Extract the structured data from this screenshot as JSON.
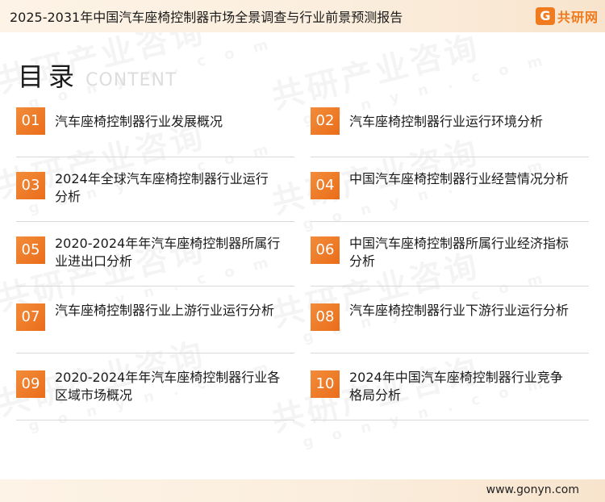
{
  "header": {
    "title": "2025-2031年中国汽车座椅控制器市场全景调查与行业前景预测报告"
  },
  "logo": {
    "badge": "G",
    "text": "共研网"
  },
  "watermark": {
    "text": "共研产业咨询",
    "url": "g o n y n . c o m"
  },
  "toc": {
    "title": "目录",
    "subtitle": "CONTENT",
    "items": [
      {
        "num": "01",
        "label": "汽车座椅控制器行业发展概况"
      },
      {
        "num": "02",
        "label": "汽车座椅控制器行业运行环境分析"
      },
      {
        "num": "03",
        "label": "2024年全球汽车座椅控制器行业运行分析"
      },
      {
        "num": "04",
        "label": "中国汽车座椅控制器行业经营情况分析"
      },
      {
        "num": "05",
        "label": "2020-2024年年汽车座椅控制器所属行业进出口分析"
      },
      {
        "num": "06",
        "label": "中国汽车座椅控制器所属行业经济指标分析"
      },
      {
        "num": "07",
        "label": "汽车座椅控制器行业上游行业运行分析"
      },
      {
        "num": "08",
        "label": "汽车座椅控制器行业下游行业运行分析"
      },
      {
        "num": "09",
        "label": "2020-2024年年汽车座椅控制器行业各区域市场概况"
      },
      {
        "num": "10",
        "label": "2024年中国汽车座椅控制器行业竞争格局分析"
      }
    ]
  },
  "footer": {
    "url": "www.gonyn.com"
  }
}
